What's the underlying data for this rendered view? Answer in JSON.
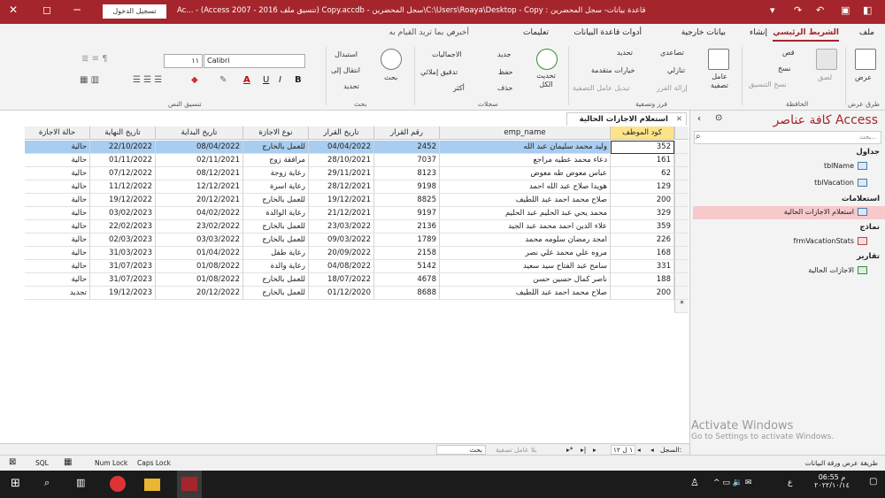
{
  "titlebar": {
    "title": "Ac...  - (Access 2007 - 2016 تنسيق ملف) Copy.accdb - سجل المحضرين\\C:\\Users\\Roaya\\Desktop - Copy : قاعدة بيانات- سجل المحضرين",
    "signin": "تسجيل الدخول",
    "min": "─",
    "max": "◻",
    "close": "✕"
  },
  "tabs": {
    "file": "ملف",
    "home": "الشريط الرئيسي",
    "create": "إنشاء",
    "external": "بيانات خارجية",
    "dbtools": "أدوات قاعدة البيانات",
    "info": "تعليمات",
    "tellme": "أخبرني بما تريد القيام به"
  },
  "ribbon": {
    "view": "عرض",
    "views_grp": "طرق عرض",
    "paste": "لصق",
    "cut": "قص",
    "copy": "نسخ",
    "format_painter": "نسخ التنسيق",
    "clipboard_grp": "الحافظة",
    "filter": "عامل تصفية",
    "ascending": "تصاعدي",
    "descending": "تنازلي",
    "remove_sort": "إزالة الفرز",
    "selection": "تحديد",
    "advanced": "خيارات متقدمة",
    "toggle_filter": "تبديل عامل التصفية",
    "sortfilter_grp": "فرز وتصفية",
    "refresh": "تحديث الكل",
    "new": "جديد",
    "save": "حفظ",
    "delete": "حذف",
    "totals": "الاجماليات",
    "spelling": "تدقيق إملائي",
    "more": "أكثر",
    "records_grp": "سجلات",
    "find": "بحث",
    "replace": "استبدال",
    "goto": "انتقال إلى",
    "select": "تحديد",
    "find_grp": "بحث",
    "font_name": "Calibri",
    "font_size": "١١",
    "text_grp": "تنسيق النص"
  },
  "doc_tab": "استعلام الاجازات الحالية",
  "columns": [
    "كود الموظف",
    "emp_name",
    "رقم القرار",
    "تاريخ القرار",
    "نوع الاجازة",
    "تاريخ البداية",
    "تاريخ النهاية",
    "حالة الاجازة"
  ],
  "rows": [
    [
      "352",
      "وليد محمد سليمان عبد الله",
      "2452",
      "04/04/2022",
      "للعمل بالخارج",
      "08/04/2022",
      "22/10/2022",
      "حالية"
    ],
    [
      "161",
      "دعاء محمد عطيه مراجع",
      "7037",
      "28/10/2021",
      "مرافقة زوج",
      "02/11/2021",
      "01/11/2022",
      "حالية"
    ],
    [
      "62",
      "عباس معوض طه معوض",
      "8123",
      "29/11/2021",
      "رعاية زوجة",
      "08/12/2021",
      "07/12/2022",
      "حالية"
    ],
    [
      "129",
      "هويدا صلاح عبد الله احمد",
      "9198",
      "28/12/2021",
      "رعاية اسرة",
      "12/12/2021",
      "11/12/2022",
      "حالية"
    ],
    [
      "200",
      "صلاح محمد احمد عبد اللطيف",
      "8825",
      "19/12/2021",
      "للعمل بالخارج",
      "20/12/2021",
      "19/12/2022",
      "حالية"
    ],
    [
      "329",
      "محمد يحي عبد الحليم عبد الحليم",
      "9197",
      "21/12/2021",
      "رعاية الوالدة",
      "04/02/2022",
      "03/02/2023",
      "حالية"
    ],
    [
      "359",
      "علاء الدين احمد محمد عبد الجيد",
      "2136",
      "23/03/2022",
      "للعمل بالخارج",
      "23/02/2022",
      "22/02/2023",
      "حالية"
    ],
    [
      "226",
      "امجد رمضان سلومه محمد",
      "1789",
      "09/03/2022",
      "للعمل بالخارج",
      "03/03/2022",
      "02/03/2023",
      "حالية"
    ],
    [
      "168",
      "مروه علي محمد علي نصر",
      "2158",
      "20/09/2022",
      "رعاية طفل",
      "01/04/2022",
      "31/03/2023",
      "حالية"
    ],
    [
      "331",
      "سامح عبد الفتاح سيد سعيد",
      "5142",
      "04/08/2022",
      "رعاية والدة",
      "01/08/2022",
      "31/07/2023",
      "حالية"
    ],
    [
      "188",
      "ناصر كمال حسين حسن",
      "4678",
      "18/07/2022",
      "للعمل بالخارج",
      "01/08/2022",
      "31/07/2023",
      "حالية"
    ],
    [
      "200",
      "صلاح محمد احمد عبد اللطيف",
      "8688",
      "01/12/2020",
      "للعمل بالخارج",
      "20/12/2022",
      "19/12/2023",
      "تجديد"
    ]
  ],
  "nav": {
    "title": "كافة عناصر Access",
    "search": "بحث...",
    "tables": "جداول",
    "tbl1": "tblName",
    "tbl2": "tblVacation",
    "queries": "استعلامات",
    "qry1": "استعلام الاجازات الحالية",
    "forms": "نماذج",
    "frm1": "frmVacationStats",
    "reports": "تقارير",
    "rpt1": "الاجازات الحالية"
  },
  "watermark": {
    "line1": "Activate Windows",
    "line2": "Go to Settings to activate Windows."
  },
  "recordnav": {
    "label": "السجل:",
    "pos": "١ ل ١٢",
    "nofilter": "بلا عامل تصفية",
    "search": "بحث"
  },
  "status": {
    "view": "طريقة عرض ورقة البيانات",
    "numlock": "Num Lock",
    "capslock": "Caps Lock",
    "sql": "SQL"
  },
  "taskbar": {
    "time": "06:55 م",
    "date": "٢٠٢٢/١٠/١٤",
    "lang": "ع"
  }
}
